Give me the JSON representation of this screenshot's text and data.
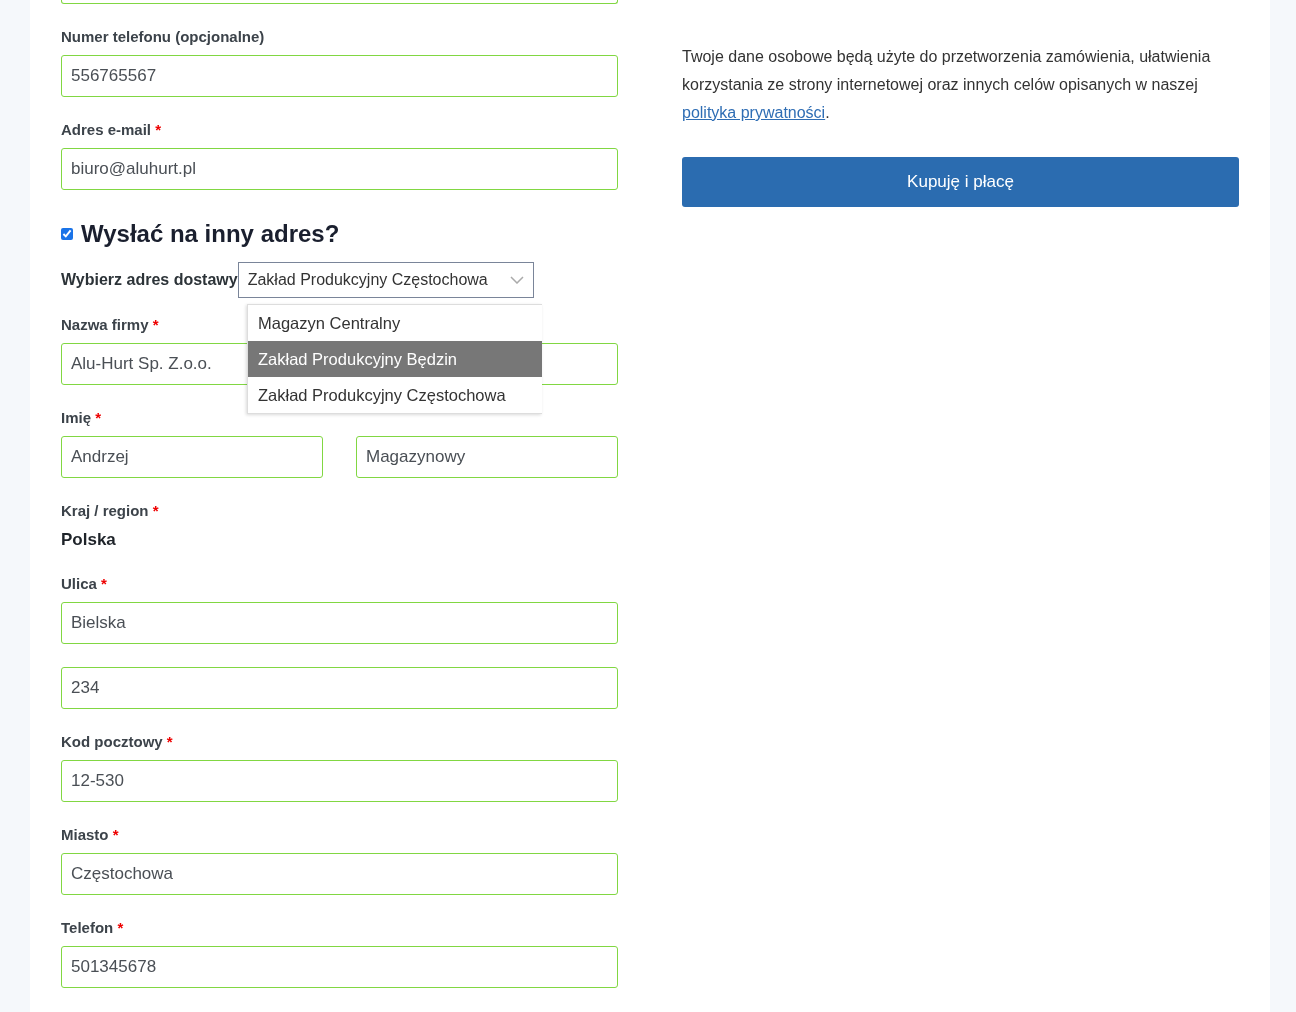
{
  "top_fields": [
    {
      "label": "Numer telefonu (opcjonalne)",
      "value": "556765567"
    },
    {
      "label": "Adres e-mail",
      "required_mark": "*",
      "value": "biuro@aluhurt.pl"
    }
  ],
  "ship_to_other": {
    "label": "Wysłać na inny adres?",
    "checked": true
  },
  "address_select": {
    "label": "Wybierz adres dostawy",
    "value": "Zakład Produkcyjny Częstochowa",
    "expanded": true,
    "options": [
      {
        "label": "Magazyn Centralny",
        "highlighted": false
      },
      {
        "label": "Zakład Produkcyjny Będzin",
        "highlighted": true
      },
      {
        "label": "Zakład Produkcyjny Częstochowa",
        "highlighted": false
      }
    ]
  },
  "shipping_rows": [
    {
      "kind": "field",
      "label": "Nazwa firmy",
      "required_mark": "*",
      "value": "Alu-Hurt Sp. Z.o.o."
    },
    {
      "kind": "field_pair",
      "label": "Imię",
      "required_mark": "*",
      "values": [
        "Andrzej",
        "Magazynowy"
      ]
    },
    {
      "kind": "static",
      "label": "Kraj / region",
      "required_mark": "*",
      "value": "Polska"
    },
    {
      "kind": "field",
      "label": "Ulica",
      "required_mark": "*",
      "value": "Bielska"
    },
    {
      "kind": "field",
      "value": "234"
    },
    {
      "kind": "field",
      "label": "Kod pocztowy",
      "required_mark": "*",
      "value": "12-530"
    },
    {
      "kind": "field",
      "label": "Miasto",
      "required_mark": "*",
      "value": "Częstochowa"
    },
    {
      "kind": "field",
      "label": "Telefon",
      "required_mark": "*",
      "value": "501345678"
    }
  ],
  "privacy": {
    "text_before": "Twoje dane osobowe będą użyte do przetworzenia zamówienia, ułatwienia korzystania ze strony internetowej oraz innych celów opisanych w naszej",
    "link": "polityka prywatności",
    "text_after": "."
  },
  "submit_button": "Kupuję i płacę"
}
